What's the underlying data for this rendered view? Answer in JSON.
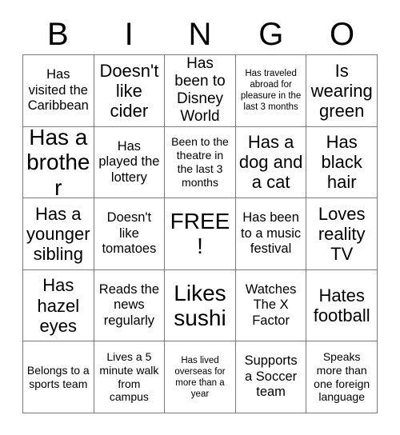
{
  "card": {
    "title": "BINGO",
    "header_letters": [
      "B",
      "I",
      "N",
      "G",
      "O"
    ],
    "free_space_label": "FREE!",
    "colors": {
      "background": "#ffffff",
      "text": "#000000",
      "grid_line": "#7a7a7a"
    },
    "rows": [
      [
        {
          "text": "Has visited the Caribbean",
          "size": "sz-m"
        },
        {
          "text": "Doesn't like cider",
          "size": "sz-xl"
        },
        {
          "text": "Has been to Disney World",
          "size": "sz-l"
        },
        {
          "text": "Has traveled abroad for pleasure in the last 3 months",
          "size": "sz-xs"
        },
        {
          "text": "Is wearing green",
          "size": "sz-xl"
        }
      ],
      [
        {
          "text": "Has a brother",
          "size": "sz-xxl"
        },
        {
          "text": "Has played the lottery",
          "size": "sz-m"
        },
        {
          "text": "Been to the theatre in the last 3 months",
          "size": "sz-s"
        },
        {
          "text": "Has a dog and a cat",
          "size": "sz-xl"
        },
        {
          "text": "Has black hair",
          "size": "sz-xl"
        }
      ],
      [
        {
          "text": "Has a younger sibling",
          "size": "sz-xl"
        },
        {
          "text": "Doesn't like tomatoes",
          "size": "sz-m"
        },
        {
          "text": "FREE!",
          "size": "sz-xxl"
        },
        {
          "text": "Has been to a music festival",
          "size": "sz-m"
        },
        {
          "text": "Loves reality TV",
          "size": "sz-xl"
        }
      ],
      [
        {
          "text": "Has hazel eyes",
          "size": "sz-xl"
        },
        {
          "text": "Reads the news regularly",
          "size": "sz-m"
        },
        {
          "text": "Likes sushi",
          "size": "sz-xxl"
        },
        {
          "text": "Watches The X Factor",
          "size": "sz-m"
        },
        {
          "text": "Hates football",
          "size": "sz-xl"
        }
      ],
      [
        {
          "text": "Belongs to a sports team",
          "size": "sz-s"
        },
        {
          "text": "Lives a 5 minute walk from campus",
          "size": "sz-s"
        },
        {
          "text": "Has lived overseas for more than a year",
          "size": "sz-xs"
        },
        {
          "text": "Supports a Soccer team",
          "size": "sz-m"
        },
        {
          "text": "Speaks more than one foreign language",
          "size": "sz-s"
        }
      ]
    ]
  }
}
